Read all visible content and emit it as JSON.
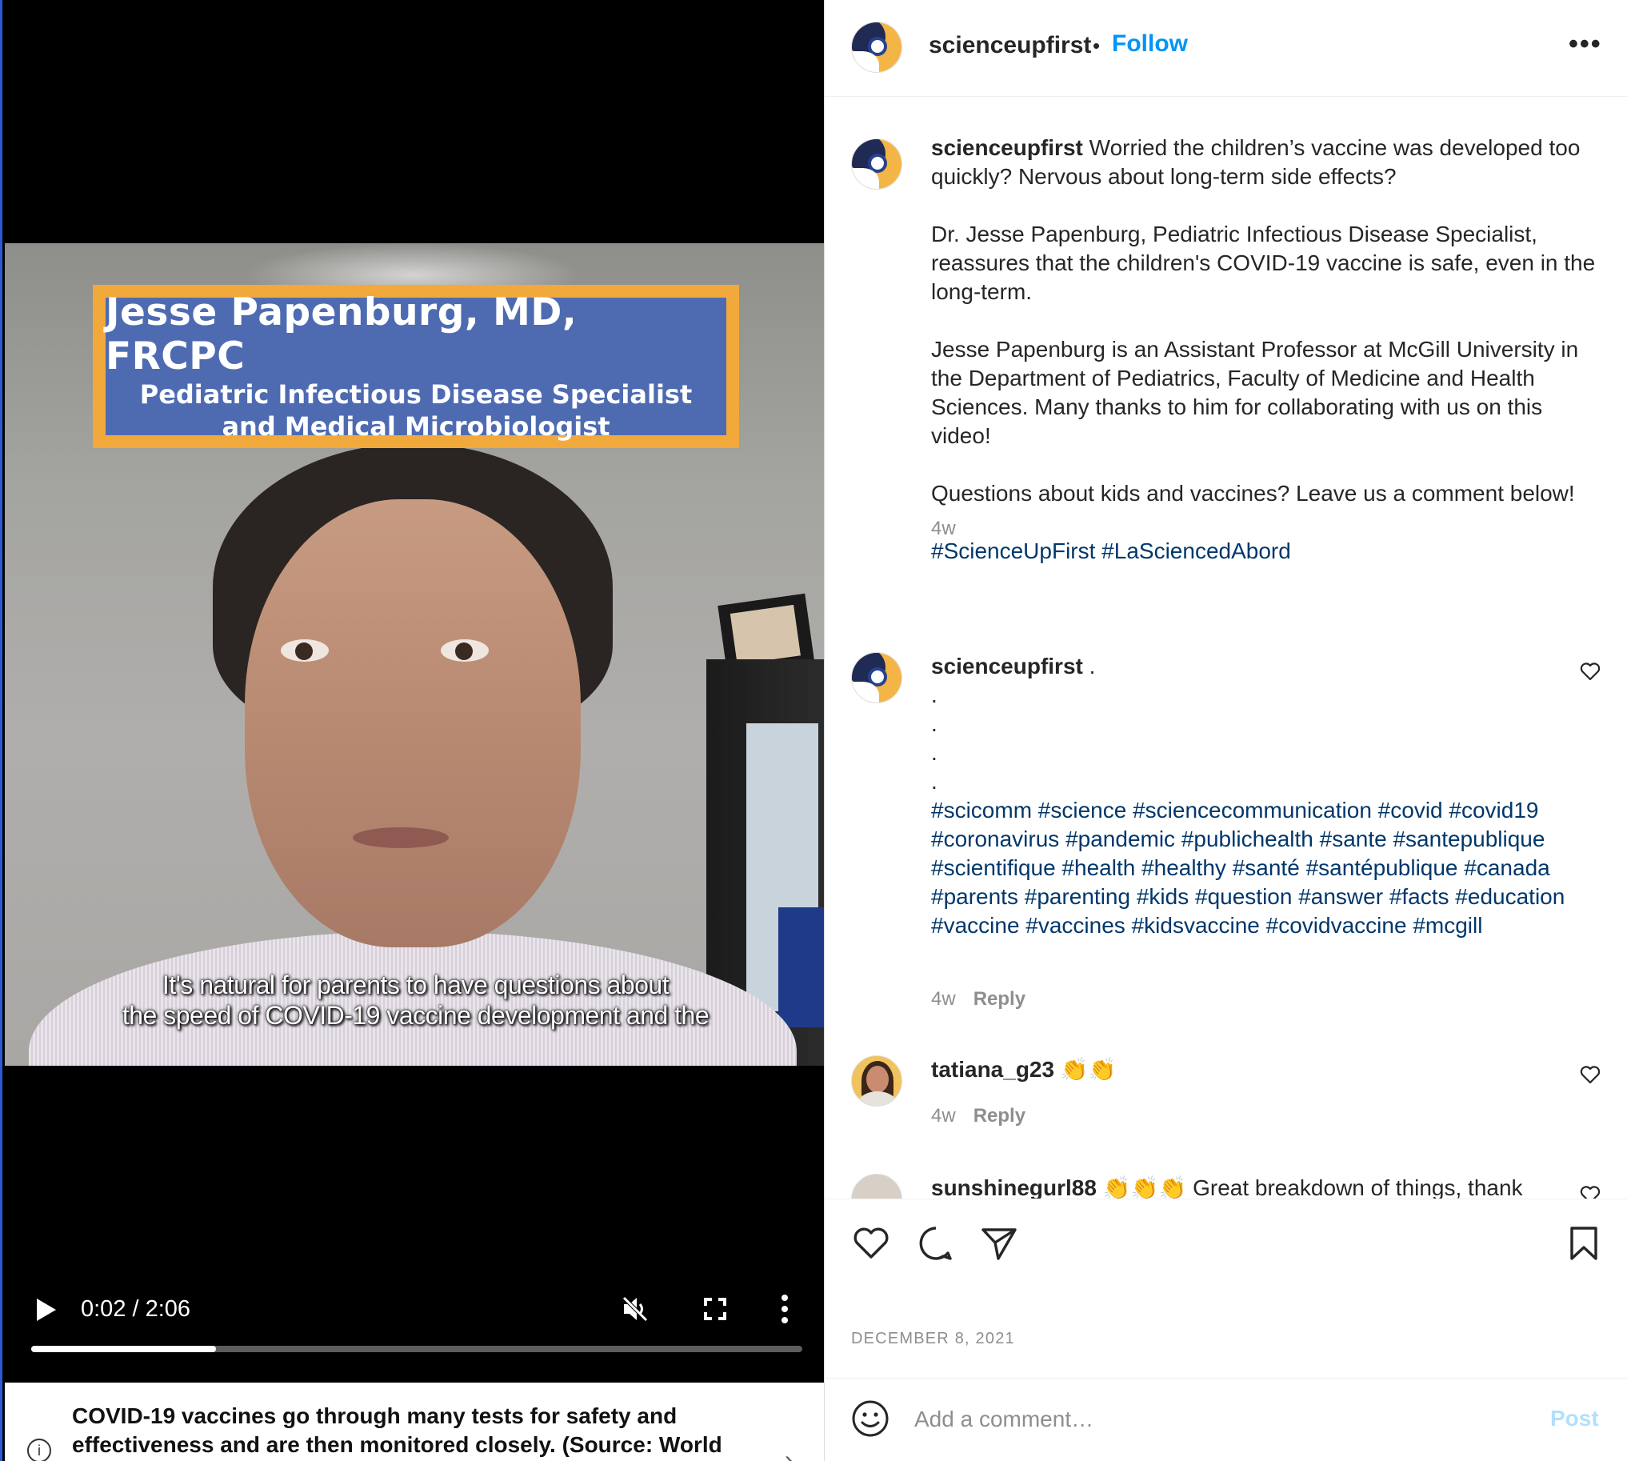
{
  "video": {
    "overlay_name": "Jesse Papenburg, MD, FRCPC",
    "overlay_title_1": "Pediatric Infectious Disease Specialist",
    "overlay_title_2": "and Medical Microbiologist",
    "subtitle_1": "It's natural for parents to have questions about",
    "subtitle_2": "the speed of COVID-19 vaccine development and the",
    "time": "0:02 / 2:06",
    "progress_fraction": 0.24,
    "icons": [
      "play-icon",
      "muted-speaker-icon",
      "fullscreen-icon",
      "vertical-dots-icon"
    ]
  },
  "info_panel": {
    "text": "COVID-19 vaccines go through many tests for safety and effectiveness and are then monitored closely. (Source: World",
    "icon": "info-icon",
    "chevron": "›"
  },
  "header": {
    "username": "scienceupfirst",
    "separator": "•",
    "follow_label": "Follow",
    "more": "•••"
  },
  "caption": {
    "username": "scienceupfirst",
    "text": "Worried the children’s vaccine was developed too quickly? Nervous about long-term side effects?\n\nDr. Jesse Papenburg, Pediatric Infectious Disease Specialist, reassures that the children's COVID-19 vaccine is safe, even in the long-term.\n\nJesse Papenburg is an Assistant Professor at McGill University in the Department of Pediatrics, Faculty of Medicine and Health Sciences. Many thanks to him for collaborating with us on this video!\n\nQuestions about kids and vaccines? Leave us a comment below!\n\n",
    "hashtags": "#ScienceUpFirst #LaSciencedAbord",
    "time": "4w"
  },
  "comments": [
    {
      "username": "scienceupfirst",
      "text": ".\n.\n.\n.\n.\n",
      "hashtags": "#scicomm #science #sciencecommunication #covid #covid19 #coronavirus #pandemic #publichealth #sante #santepublique #scientifique #health #healthy #santé #santépublique #canada #parents #parenting #kids #question #answer #facts #education #vaccine #vaccines #kidsvaccine #covidvaccine #mcgill",
      "time": "4w",
      "reply": "Reply"
    },
    {
      "username": "tatiana_g23",
      "text": "👏👏",
      "time": "4w",
      "reply": "Reply"
    },
    {
      "username": "sunshinegurl88",
      "text": "👏👏👏 Great breakdown of things, thank"
    }
  ],
  "actions": {
    "icons": [
      "heart-icon",
      "comment-icon",
      "share-icon",
      "bookmark-icon"
    ]
  },
  "date": "DECEMBER 8, 2021",
  "composer": {
    "placeholder": "Add a comment…",
    "post_label": "Post"
  },
  "colors": {
    "accent": "#0095f6",
    "hashtag": "#00376b",
    "muted": "#8e8e8e",
    "nameplate_border": "#f2a93c",
    "nameplate_fill": "#4e6bb2"
  }
}
